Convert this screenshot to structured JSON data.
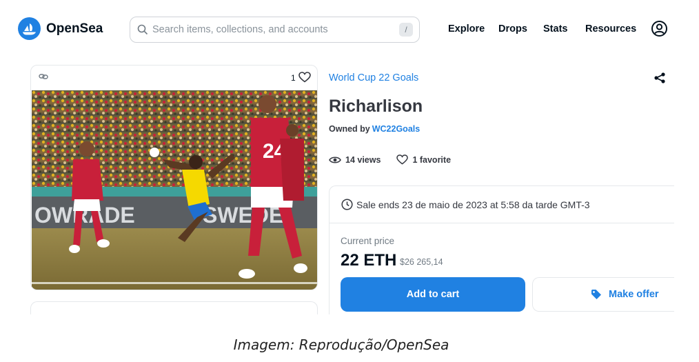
{
  "header": {
    "logo_text": "OpenSea",
    "search_placeholder": "Search items, collections, and accounts",
    "search_shortcut": "/",
    "nav": [
      "Explore",
      "Drops",
      "Stats",
      "Resources"
    ],
    "icons": [
      "opensea-logo-icon",
      "search-icon",
      "account-icon"
    ]
  },
  "item_card": {
    "favorite_count": "1",
    "icons": [
      "chain-link-icon",
      "heart-icon"
    ]
  },
  "details": {
    "collection": "World Cup 22 Goals",
    "title": "Richarlison",
    "owned_by_label": "Owned by",
    "owner": "WC22Goals",
    "views": "14 views",
    "favorites": "1 favorite"
  },
  "sale": {
    "ends_text": "Sale ends 23 de maio de 2023 at 5:58 da tarde GMT-3",
    "current_price_label": "Current price",
    "price": "22 ETH",
    "price_fiat": "$26 265,14",
    "add_to_cart": "Add to cart",
    "make_offer": "Make offer"
  },
  "caption": "Imagem: Reprodução/OpenSea",
  "colors": {
    "accent": "#2081e2",
    "text": "#04111d",
    "border": "#e5e8eb",
    "jersey_red": "#c8203a",
    "jersey_yellow": "#f5d900",
    "pitch": "#8c7a3e"
  }
}
